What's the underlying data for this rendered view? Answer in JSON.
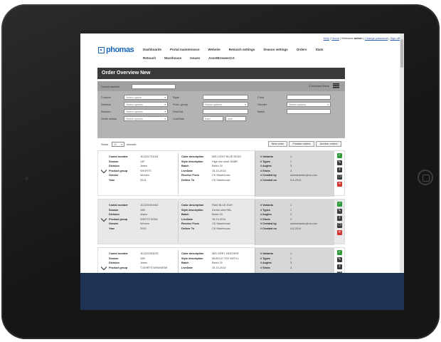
{
  "toplinks": {
    "help": "Help",
    "home": "Home",
    "welcome": "Welcome",
    "user": "admin",
    "change_password": "Change password",
    "sign_off": "Sign off"
  },
  "logo": {
    "text": "phomas"
  },
  "nav": {
    "row1": [
      "Dashboards",
      "Portal maintenance",
      "Website",
      "Retouch settings",
      "Season settings",
      "Orders",
      "Stats"
    ],
    "row2": [
      "Retouch",
      "Warehouse",
      "Issues",
      "AssetBrowser2.0"
    ]
  },
  "page": {
    "title": "Order Overview New"
  },
  "filters": {
    "combi_number": "Combi number",
    "selected_filters": "5 selected filters",
    "labels": {
      "custom": "Custom",
      "division": "Division",
      "season": "Season",
      "order_status": "Order status",
      "style": "Style",
      "prod_group": "Prod. group",
      "shot_list": "Shot list",
      "live_date": "LiveDate",
      "color": "Color",
      "gender": "Gender",
      "batch": "Batch"
    },
    "select_option": "Select option",
    "select_options": "Select options",
    "date_from": "from",
    "date_until": "until"
  },
  "toolbar": {
    "show": "Show",
    "page_size": "20",
    "records": "records",
    "new_order": "New order",
    "finalize_orders": "Finalize orders",
    "archive_orders": "Archive orders"
  },
  "orders": [
    {
      "left": [
        [
          "Combi number",
          "JDJ201731163"
        ],
        [
          "Season",
          "14F"
        ],
        [
          "Division",
          "Jeans"
        ],
        [
          "Product group",
          "SHORTS"
        ],
        [
          "Gender",
          "Women"
        ],
        [
          "Year",
          "2014"
        ]
      ],
      "middle": [
        [
          "Color description",
          "505 LIGHT BLUE RIGID"
        ],
        [
          "Style description",
          "High rise short SABR"
        ],
        [
          "Batch",
          "Batch 20"
        ],
        [
          "LiveDate",
          "15-10-2014"
        ],
        [
          "Receive From",
          "CK Warehouse"
        ],
        [
          "Deliver To",
          "CK Warehouse"
        ]
      ],
      "right": [
        [
          "# Variants",
          "1"
        ],
        [
          "# Types",
          "1"
        ],
        [
          "# Angles",
          "3"
        ],
        [
          "# Shots",
          "3"
        ],
        [
          "# Created by",
          "sonnantaden@ck.com"
        ],
        [
          "# Created on",
          "5-8-2014"
        ]
      ]
    },
    {
      "left": [
        [
          "Combi number",
          "JDJ201904462"
        ],
        [
          "Season",
          "10B"
        ],
        [
          "Division",
          "Jeans"
        ],
        [
          "Product group",
          "SHIRTS WSW"
        ],
        [
          "Gender",
          "Women"
        ],
        [
          "Year",
          "2015"
        ]
      ],
      "middle": [
        [
          "Color description",
          "RAW BLUE-EUR"
        ],
        [
          "Style description",
          "Denim shirt RBL"
        ],
        [
          "Batch",
          "Batch 20"
        ],
        [
          "LiveDate",
          "15-10-2014"
        ],
        [
          "Receive From",
          "CK Warehouse"
        ],
        [
          "Deliver To",
          "CK Warehouse"
        ]
      ],
      "right": [
        [
          "# Variants",
          "1"
        ],
        [
          "# Types",
          "1"
        ],
        [
          "# Angles",
          "3"
        ],
        [
          "# Shots",
          "3"
        ],
        [
          "# Created by",
          "sonnantaden@ck.com"
        ],
        [
          "# Created on",
          "4-8-2014"
        ]
      ]
    },
    {
      "left": [
        [
          "Combi number",
          "JDJ201903025"
        ],
        [
          "Season",
          "10B"
        ],
        [
          "Division",
          "Jeans"
        ],
        [
          "Product group",
          "T-SHIRTS WSW/MSW"
        ]
      ],
      "middle": [
        [
          "Color description",
          "MID GREY HEATHER"
        ],
        [
          "Style description",
          "MUSCLE TEE WITH L"
        ],
        [
          "Batch",
          "Batch 20"
        ],
        [
          "LiveDate",
          "15-10-2014"
        ]
      ],
      "right": [
        [
          "# Variants",
          "1"
        ],
        [
          "# Types",
          "1"
        ],
        [
          "# Angles",
          "3"
        ],
        [
          "# Shots",
          "3"
        ]
      ]
    }
  ],
  "colors": {
    "title_bar": "#3a3a3a",
    "filter_panel": "#b3b3b3",
    "brand": "#1a66b8",
    "footer": "#1f3354",
    "green": "#2f9a3a",
    "red": "#d2322d"
  }
}
